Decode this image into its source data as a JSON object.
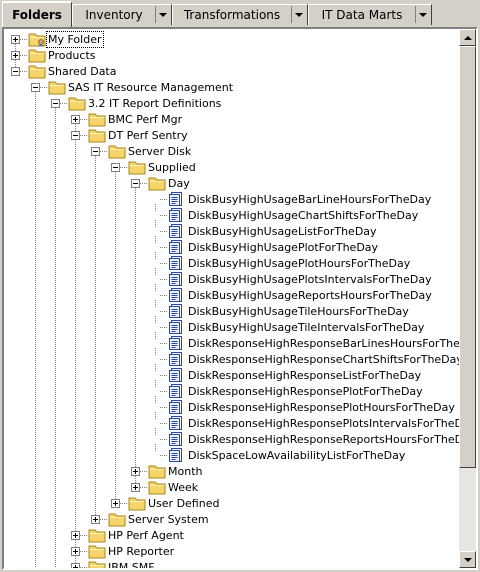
{
  "tabs": [
    {
      "label": "Folders",
      "active": true,
      "has_dropdown": false
    },
    {
      "label": "Inventory",
      "active": false,
      "has_dropdown": true
    },
    {
      "label": "Transformations",
      "active": false,
      "has_dropdown": true
    },
    {
      "label": "IT Data Marts",
      "active": false,
      "has_dropdown": true
    }
  ],
  "tree": [
    {
      "label": "My Folder",
      "depth": 0,
      "type": "folder",
      "expander": "plus",
      "variant": "my",
      "focused": true
    },
    {
      "label": "Products",
      "depth": 0,
      "type": "folder",
      "expander": "plus"
    },
    {
      "label": "Shared Data",
      "depth": 0,
      "type": "folder",
      "expander": "minus"
    },
    {
      "label": "SAS IT Resource Management",
      "depth": 1,
      "type": "folder",
      "expander": "minus"
    },
    {
      "label": "3.2 IT Report Definitions",
      "depth": 2,
      "type": "folder",
      "expander": "minus"
    },
    {
      "label": "BMC Perf Mgr",
      "depth": 3,
      "type": "folder",
      "expander": "plus"
    },
    {
      "label": "DT Perf Sentry",
      "depth": 3,
      "type": "folder",
      "expander": "minus"
    },
    {
      "label": "Server Disk",
      "depth": 4,
      "type": "folder",
      "expander": "minus"
    },
    {
      "label": "Supplied",
      "depth": 5,
      "type": "folder",
      "expander": "minus"
    },
    {
      "label": "Day",
      "depth": 6,
      "type": "folder",
      "expander": "minus"
    },
    {
      "label": "DiskBusyHighUsageBarLineHoursForTheDay",
      "depth": 7,
      "type": "report"
    },
    {
      "label": "DiskBusyHighUsageChartShiftsForTheDay",
      "depth": 7,
      "type": "report"
    },
    {
      "label": "DiskBusyHighUsageListForTheDay",
      "depth": 7,
      "type": "report"
    },
    {
      "label": "DiskBusyHighUsagePlotForTheDay",
      "depth": 7,
      "type": "report"
    },
    {
      "label": "DiskBusyHighUsagePlotHoursForTheDay",
      "depth": 7,
      "type": "report"
    },
    {
      "label": "DiskBusyHighUsagePlotsIntervalsForTheDay",
      "depth": 7,
      "type": "report"
    },
    {
      "label": "DiskBusyHighUsageReportsHoursForTheDay",
      "depth": 7,
      "type": "report"
    },
    {
      "label": "DiskBusyHighUsageTileHoursForTheDay",
      "depth": 7,
      "type": "report"
    },
    {
      "label": "DiskBusyHighUsageTileIntervalsForTheDay",
      "depth": 7,
      "type": "report"
    },
    {
      "label": "DiskResponseHighResponseBarLinesHoursForTheDay",
      "depth": 7,
      "type": "report"
    },
    {
      "label": "DiskResponseHighResponseChartShiftsForTheDay",
      "depth": 7,
      "type": "report"
    },
    {
      "label": "DiskResponseHighResponseListForTheDay",
      "depth": 7,
      "type": "report"
    },
    {
      "label": "DiskResponseHighResponsePlotForTheDay",
      "depth": 7,
      "type": "report"
    },
    {
      "label": "DiskResponseHighResponsePlotHoursForTheDay",
      "depth": 7,
      "type": "report"
    },
    {
      "label": "DiskResponseHighResponsePlotsIntervalsForTheDay",
      "depth": 7,
      "type": "report"
    },
    {
      "label": "DiskResponseHighResponseReportsHoursForTheDay",
      "depth": 7,
      "type": "report"
    },
    {
      "label": "DiskSpaceLowAvailabilityListForTheDay",
      "depth": 7,
      "type": "report"
    },
    {
      "label": "Month",
      "depth": 6,
      "type": "folder",
      "expander": "plus"
    },
    {
      "label": "Week",
      "depth": 6,
      "type": "folder",
      "expander": "plus"
    },
    {
      "label": "User Defined",
      "depth": 5,
      "type": "folder",
      "expander": "plus"
    },
    {
      "label": "Server System",
      "depth": 4,
      "type": "folder",
      "expander": "plus"
    },
    {
      "label": "HP Perf Agent",
      "depth": 3,
      "type": "folder",
      "expander": "plus"
    },
    {
      "label": "HP Reporter",
      "depth": 3,
      "type": "folder",
      "expander": "plus"
    },
    {
      "label": "IBM SMF",
      "depth": 3,
      "type": "folder",
      "expander": "plus"
    }
  ],
  "colors": {
    "folder_fill": "#f6d66a",
    "folder_edge": "#a8841c",
    "report_blue": "#2848a8",
    "tree_line": "#808080"
  },
  "icons": {
    "folder": "folder-icon",
    "report": "report-icon",
    "my_folder": "my-folder-icon"
  }
}
